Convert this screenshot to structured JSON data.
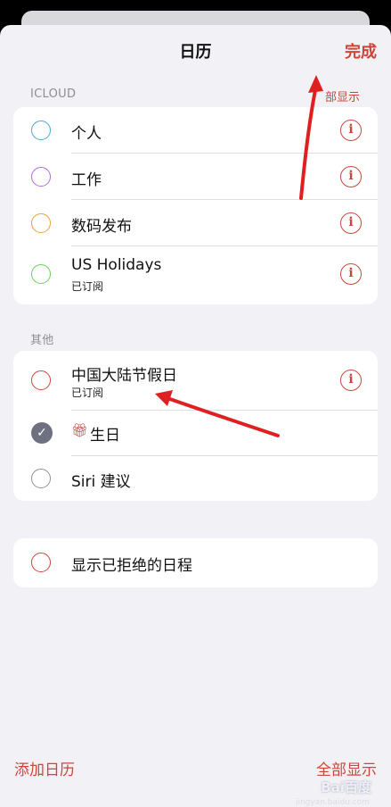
{
  "header": {
    "title": "日历",
    "done_label": "完成"
  },
  "icloud": {
    "section_label": "ICLOUD",
    "section_action": "部显示",
    "items": [
      {
        "label": "个人",
        "sublabel": "",
        "color": "#4aa8d8"
      },
      {
        "label": "工作",
        "sublabel": "",
        "color": "#b36ad3"
      },
      {
        "label": "数码发布",
        "sublabel": "",
        "color": "#e6a23c"
      },
      {
        "label": "US Holidays",
        "sublabel": "已订阅",
        "color": "#6bd05a"
      }
    ]
  },
  "other": {
    "section_label": "其他",
    "items": [
      {
        "label": "中国大陆节假日",
        "sublabel": "已订阅",
        "color": "#d0443a"
      },
      {
        "label": "生日",
        "checked": true
      },
      {
        "label": "Siri 建议",
        "color": "#8e9299"
      }
    ]
  },
  "declined": {
    "label": "显示已拒绝的日程",
    "color": "#d0443a"
  },
  "footer": {
    "add_calendar": "添加日历",
    "show_all": "全部显示"
  },
  "watermark": {
    "brand": "Bai百度",
    "sub": "jingyan.baidu.com"
  },
  "colors": {
    "accent": "#d0443a",
    "annotation_arrow": "#e02020"
  }
}
